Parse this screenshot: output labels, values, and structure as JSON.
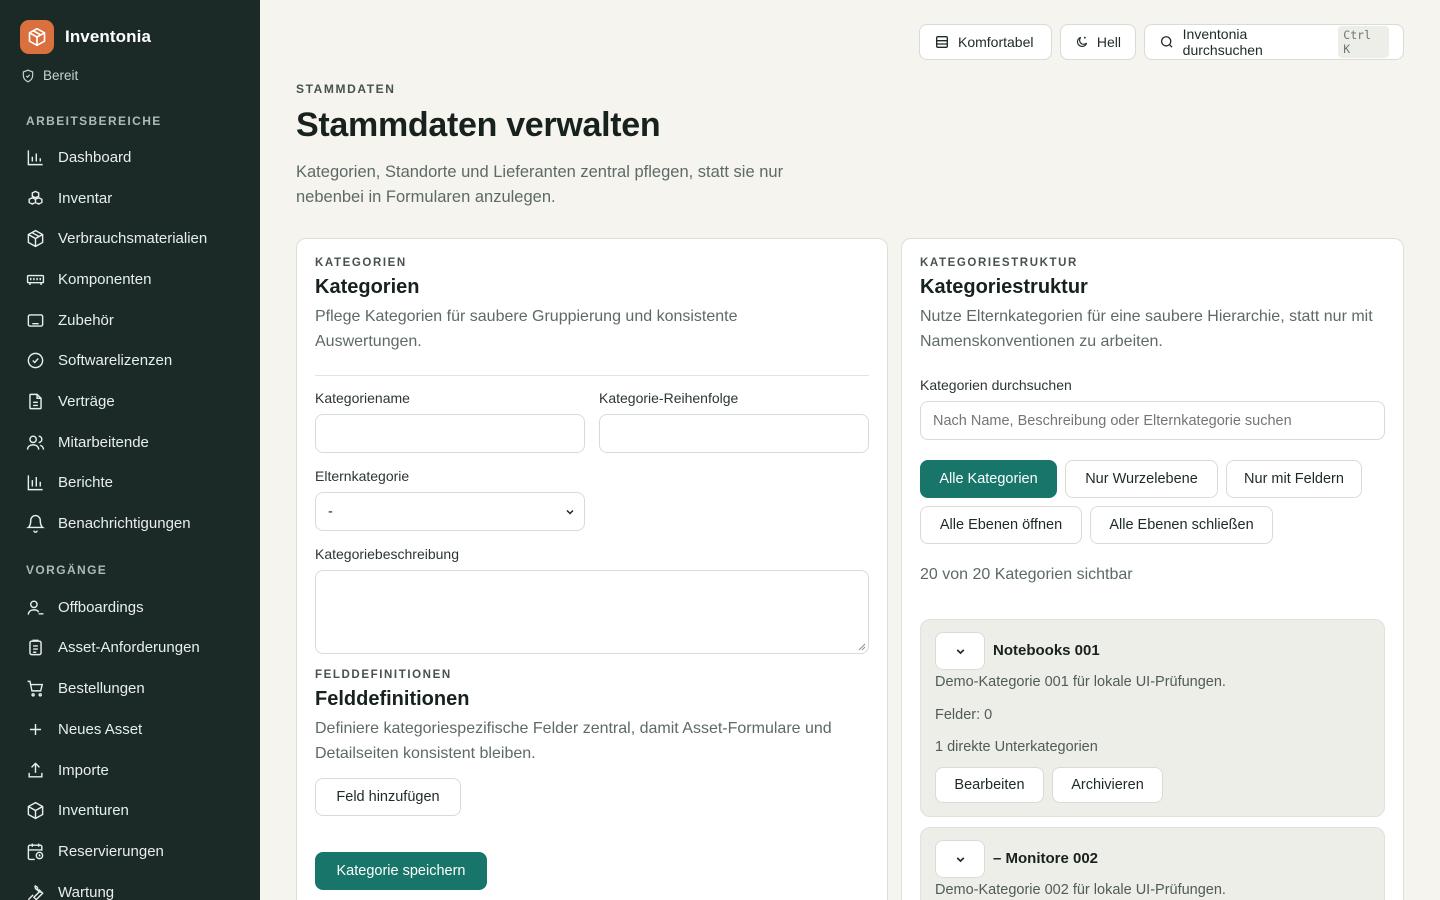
{
  "app": {
    "name": "Inventonia",
    "status": "Bereit"
  },
  "sidebar": {
    "section_work": "ARBEITSBEREICHE",
    "work_items": [
      {
        "label": "Dashboard",
        "icon": "bar-chart-icon"
      },
      {
        "label": "Inventar",
        "icon": "boxes-icon"
      },
      {
        "label": "Verbrauchsmaterialien",
        "icon": "package-icon"
      },
      {
        "label": "Komponenten",
        "icon": "memory-icon"
      },
      {
        "label": "Zubehör",
        "icon": "keyboard-icon"
      },
      {
        "label": "Softwarelizenzen",
        "icon": "badge-check-icon"
      },
      {
        "label": "Verträge",
        "icon": "document-icon"
      },
      {
        "label": "Mitarbeitende",
        "icon": "users-icon"
      },
      {
        "label": "Berichte",
        "icon": "report-chart-icon"
      },
      {
        "label": "Benachrichtigungen",
        "icon": "bell-icon"
      }
    ],
    "section_processes": "VORGÄNGE",
    "process_items": [
      {
        "label": "Offboardings",
        "icon": "user-minus-icon"
      },
      {
        "label": "Asset-Anforderungen",
        "icon": "clipboard-icon"
      },
      {
        "label": "Bestellungen",
        "icon": "cart-icon"
      },
      {
        "label": "Neues Asset",
        "icon": "plus-icon"
      },
      {
        "label": "Importe",
        "icon": "upload-icon"
      },
      {
        "label": "Inventuren",
        "icon": "package-check-icon"
      },
      {
        "label": "Reservierungen",
        "icon": "calendar-clock-icon"
      },
      {
        "label": "Wartung",
        "icon": "wrench-icon"
      }
    ]
  },
  "topbar": {
    "density_label": "Komfortabel",
    "theme_label": "Hell",
    "search_label": "Inventonia durchsuchen",
    "search_shortcut": "Ctrl K"
  },
  "header": {
    "eyebrow": "STAMMDATEN",
    "title": "Stammdaten verwalten",
    "description": "Kategorien, Standorte und Lieferanten zentral pflegen, statt sie nur nebenbei in Formularen anzulegen."
  },
  "categories_card": {
    "eyebrow": "KATEGORIEN",
    "title": "Kategorien",
    "description": "Pflege Kategorien für saubere Gruppierung und konsistente Auswertungen.",
    "name_label": "Kategoriename",
    "name_value": "",
    "order_label": "Kategorie-Reihenfolge",
    "order_value": "",
    "parent_label": "Elternkategorie",
    "parent_selected": "-",
    "description_label": "Kategoriebeschreibung",
    "fields_eyebrow": "FELDDEFINITIONEN",
    "fields_title": "Felddefinitionen",
    "fields_description": "Definiere kategoriespezifische Felder zentral, damit Asset-Formulare und Detailseiten konsistent bleiben.",
    "add_field_label": "Feld hinzufügen",
    "save_label": "Kategorie speichern"
  },
  "structure_card": {
    "eyebrow": "KATEGORIESTRUKTUR",
    "title": "Kategoriestruktur",
    "description": "Nutze Elternkategorien für eine saubere Hierarchie, statt nur mit Namenskonventionen zu arbeiten.",
    "search_label": "Kategorien durchsuchen",
    "search_placeholder": "Nach Name, Beschreibung oder Elternkategorie suchen",
    "filter_all": "Alle Kategorien",
    "filter_root": "Nur Wurzelebene",
    "filter_fields": "Nur mit Feldern",
    "expand_all": "Alle Ebenen öffnen",
    "collapse_all": "Alle Ebenen schließen",
    "visible_count": "20 von 20 Kategorien sichtbar",
    "nodes": [
      {
        "name": "Notebooks 001",
        "description": "Demo-Kategorie 001 für lokale UI-Prüfungen.",
        "fields": "Felder: 0",
        "children": "1 direkte Unterkategorien",
        "edit_label": "Bearbeiten",
        "archive_label": "Archivieren"
      },
      {
        "name": "– Monitore 002",
        "description": "Demo-Kategorie 002 für lokale UI-Prüfungen."
      }
    ]
  },
  "colors": {
    "sidebar_bg": "#1b2a27",
    "accent": "#17756a",
    "brand": "#d9703e",
    "page_bg": "#f5f4ef"
  }
}
